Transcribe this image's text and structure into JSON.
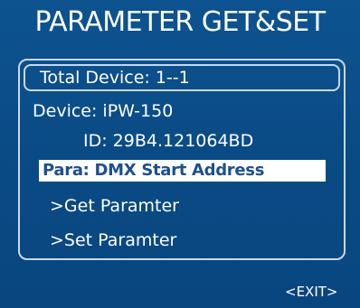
{
  "header": {
    "title": "PARAMETER GET&SET"
  },
  "info": {
    "total_device": "Total Device: 1--1",
    "device": "Device: iPW-150",
    "id": "ID: 29B4.121064BD"
  },
  "menu": {
    "items": [
      {
        "label": "Para: DMX Start Address",
        "selected": true
      },
      {
        "label": ">Get Paramter",
        "selected": false
      },
      {
        "label": ">Set Paramter",
        "selected": false
      }
    ]
  },
  "footer": {
    "exit_label": "<EXIT>"
  },
  "colors": {
    "background": "#0a4c86",
    "text": "#ffffff",
    "highlight_bg": "#ffffff",
    "highlight_text": "#1e4f8d",
    "border": "#c8d8ee"
  }
}
